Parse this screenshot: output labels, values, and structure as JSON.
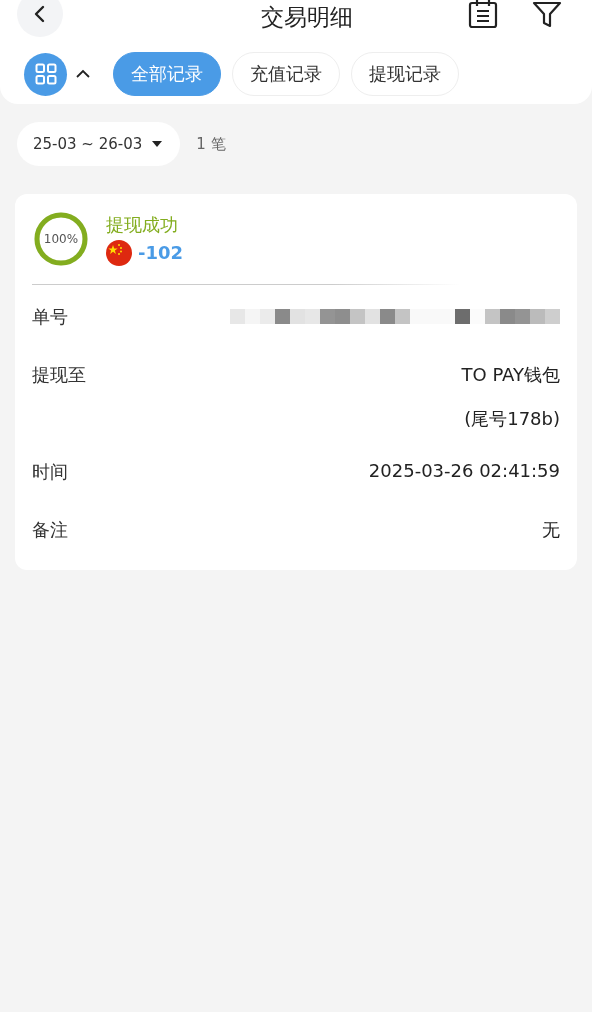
{
  "header": {
    "title": "交易明细"
  },
  "tabs": [
    {
      "label": "全部记录",
      "selected": true
    },
    {
      "label": "充值记录",
      "selected": false
    },
    {
      "label": "提现记录",
      "selected": false
    }
  ],
  "filter": {
    "date_range": "25-03 ~ 26-03",
    "count": "1 笔"
  },
  "record": {
    "progress": {
      "level": 1,
      "label": "100%"
    },
    "status": "提现成功",
    "amount": "-102",
    "fields": [
      {
        "label": "单号",
        "kind": "redacted"
      },
      {
        "label": "提现至",
        "kind": "text",
        "lines": [
          "TO PAY钱包",
          "(尾号178b)"
        ]
      },
      {
        "label": "时间",
        "kind": "text",
        "lines": [
          "2025-03-26 02:41:59"
        ]
      },
      {
        "label": "备注",
        "kind": "text",
        "lines": [
          "无"
        ]
      }
    ]
  }
}
